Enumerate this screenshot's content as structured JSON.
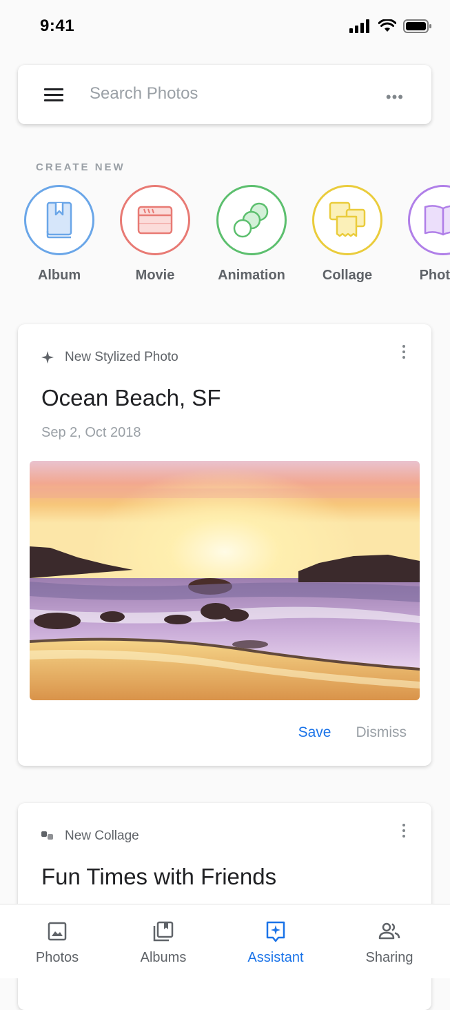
{
  "status_bar": {
    "time": "9:41"
  },
  "search": {
    "placeholder": "Search Photos"
  },
  "create_new": {
    "heading": "CREATE NEW",
    "items": [
      {
        "label": "Album",
        "icon": "album-book-icon",
        "color": "#6aa6e8"
      },
      {
        "label": "Movie",
        "icon": "movie-clapper-icon",
        "color": "#e87a74"
      },
      {
        "label": "Animation",
        "icon": "animation-circles-icon",
        "color": "#5cbf6e"
      },
      {
        "label": "Collage",
        "icon": "collage-squares-icon",
        "color": "#eacc3c"
      },
      {
        "label": "Photob",
        "icon": "photobook-icon",
        "color": "#b07fe8"
      }
    ]
  },
  "cards": [
    {
      "kind": "New Stylized Photo",
      "kind_icon": "sparkle-icon",
      "title": "Ocean Beach, SF",
      "date": "Sep 2, Oct 2018",
      "actions": {
        "save": "Save",
        "dismiss": "Dismiss"
      }
    },
    {
      "kind": "New Collage",
      "kind_icon": "collage-small-icon",
      "title": "Fun Times with Friends"
    }
  ],
  "bottom_nav": {
    "active": "Assistant",
    "items": [
      {
        "label": "Photos",
        "icon": "photos-icon"
      },
      {
        "label": "Albums",
        "icon": "albums-icon"
      },
      {
        "label": "Assistant",
        "icon": "assistant-icon"
      },
      {
        "label": "Sharing",
        "icon": "sharing-icon"
      }
    ]
  },
  "colors": {
    "accent": "#1a73e8",
    "muted": "#9aa0a6"
  }
}
